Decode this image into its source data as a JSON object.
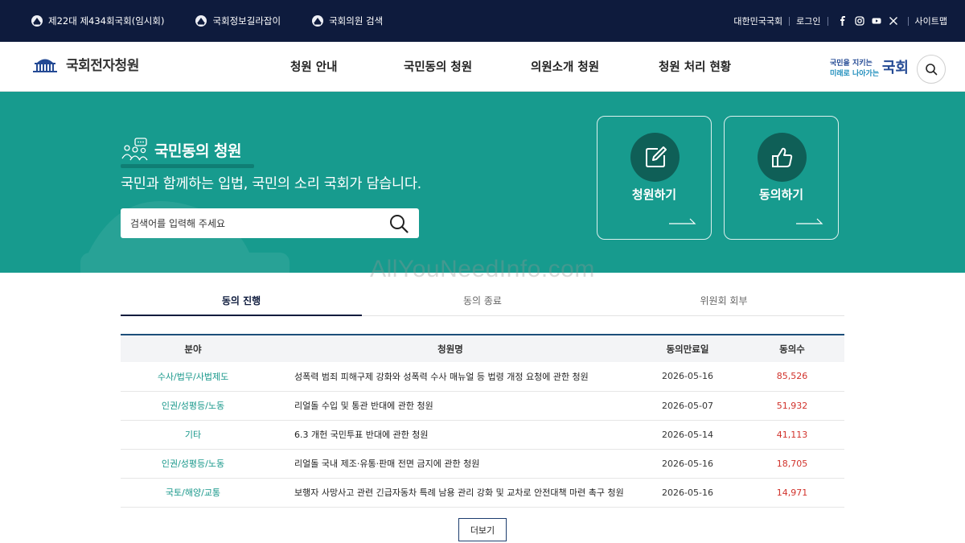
{
  "topbar": {
    "left_links": [
      {
        "label": "제22대 제434회국회(임시회)"
      },
      {
        "label": "국회정보길라잡이"
      },
      {
        "label": "국회의원 검색"
      }
    ],
    "right_links": {
      "assembly": "대한민국국회",
      "login": "로그인",
      "sitemap": "사이트맵"
    },
    "sns": [
      "facebook-icon",
      "instagram-icon",
      "youtube-icon",
      "x-icon"
    ]
  },
  "header": {
    "logo_text": "국회전자청원",
    "menu": [
      "청원 안내",
      "국민동의 청원",
      "의원소개 청원",
      "청원 처리 현황"
    ],
    "slogan": {
      "line1": "국민을 지키는",
      "line2": "미래로 나아가는",
      "mark": "국회"
    }
  },
  "hero": {
    "title": "국민동의 청원",
    "subtitle": "국민과 함께하는 입법, 국민의 소리 국회가 담습니다.",
    "search_placeholder": "검색어를 입력해 주세요",
    "actions": [
      {
        "label": "청원하기",
        "icon": "pen-square-icon"
      },
      {
        "label": "동의하기",
        "icon": "thumbs-up-icon"
      }
    ]
  },
  "watermark": "AllYouNeedInfo.com",
  "tabs": [
    {
      "label": "동의 진행",
      "active": true
    },
    {
      "label": "동의 종료",
      "active": false
    },
    {
      "label": "위원회 회부",
      "active": false
    }
  ],
  "table": {
    "headers": [
      "분야",
      "청원명",
      "동의만료일",
      "동의수"
    ],
    "rows": [
      {
        "category": "수사/법무/사법제도",
        "title": "성폭력 범죄 피해구제 강화와 성폭력 수사 매뉴얼 등 법령 개정 요청에 관한 청원",
        "date": "2026-05-16",
        "count": "85,526"
      },
      {
        "category": "인권/성평등/노동",
        "title": "리얼돌 수입 및 통관 반대에 관한 청원",
        "date": "2026-05-07",
        "count": "51,932"
      },
      {
        "category": "기타",
        "title": "6.3 개헌 국민투표 반대에 관한 청원",
        "date": "2026-05-14",
        "count": "41,113"
      },
      {
        "category": "인권/성평등/노동",
        "title": "리얼돌 국내 제조·유통·판매 전면 금지에 관한 청원",
        "date": "2026-05-16",
        "count": "18,705"
      },
      {
        "category": "국토/해양/교통",
        "title": "보행자 사망사고 관련 긴급자동차 특례 남용 관리 강화 및 교차로 안전대책 마련 촉구 청원",
        "date": "2026-05-16",
        "count": "14,971"
      }
    ]
  },
  "more_label": "더보기",
  "colors": {
    "topbar_bg": "#0e1b3d",
    "hero_bg": "#179b8e",
    "category_text": "#17978a",
    "count_text": "#d1322b"
  }
}
